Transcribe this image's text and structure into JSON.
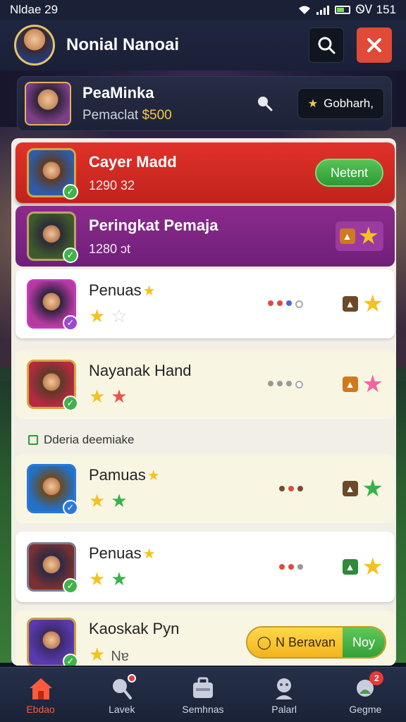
{
  "status": {
    "left": "Nldae 29",
    "right": "ᏫᏙ 151"
  },
  "header": {
    "title": "Nonial Nanoai"
  },
  "profile": {
    "name": "PeaMinka",
    "sub_prefix": "Pemaclat",
    "sub_amount": "$500",
    "button_label": "Gobharh,"
  },
  "rows": [
    {
      "title": "Cayer Madd",
      "sub": "1290 32",
      "action": "Netent"
    },
    {
      "title": "Peringkat Pemaja",
      "sub": "1280 ɔt"
    },
    {
      "title": "Penuas"
    },
    {
      "title": "Nayanak Hand"
    },
    {
      "title": "Pamuas"
    },
    {
      "title": "Penuas"
    },
    {
      "title": "Kaoskak Pyn",
      "suffix": "Nɐ",
      "action_left": "N Beravan",
      "action_right": "Noy"
    }
  ],
  "section": {
    "label": "Dderia deemiake"
  },
  "nav": [
    {
      "label": "Ebdao",
      "icon": "home-icon"
    },
    {
      "label": "Lavek",
      "icon": "search-icon"
    },
    {
      "label": "Semhnas",
      "icon": "briefcase-icon"
    },
    {
      "label": "Palarl",
      "icon": "profile-icon"
    },
    {
      "label": "Gegme",
      "icon": "game-icon",
      "badge": "2"
    }
  ],
  "colors": {
    "red_row": "#d22a22",
    "purple_row": "#7e2585",
    "accent_gold": "#f4c21f",
    "accent_green": "#3fb24a",
    "nav_active": "#ff5a3c"
  }
}
